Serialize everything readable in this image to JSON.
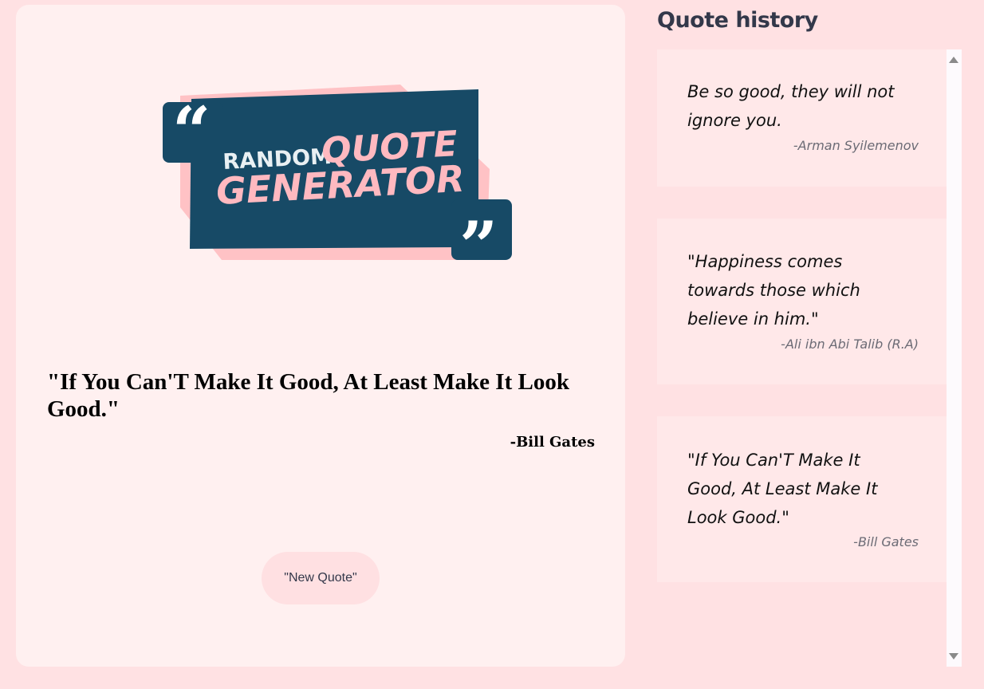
{
  "logo": {
    "word1": "RANDOM",
    "word2": "QUOTE",
    "word3": "GENERATOR",
    "colors": {
      "dark": "#174a66",
      "pink": "#ffc2c5",
      "pink_text": "#ffb9c0",
      "light": "#e9f0f3"
    }
  },
  "current_quote": {
    "text": "\"If You Can'T Make It Good, At Least Make It Look Good.\"",
    "author": "-Bill Gates"
  },
  "new_quote_button": {
    "label": "\"New Quote\""
  },
  "history": {
    "title": "Quote history",
    "items": [
      {
        "quote": "Be so good, they will not ignore you.",
        "author": "-Arman Syilemenov"
      },
      {
        "quote": "\"Happiness comes towards those which believe in him.\"",
        "author": "-Ali ibn Abi Talib (R.A)"
      },
      {
        "quote": "\"If You Can'T Make It Good, At Least Make It Look Good.\"",
        "author": "-Bill Gates"
      }
    ]
  },
  "colors": {
    "background": "#ffe1e3",
    "card": "#fff0f0",
    "history_item": "#ffe8e9",
    "title_text": "#33384a"
  }
}
